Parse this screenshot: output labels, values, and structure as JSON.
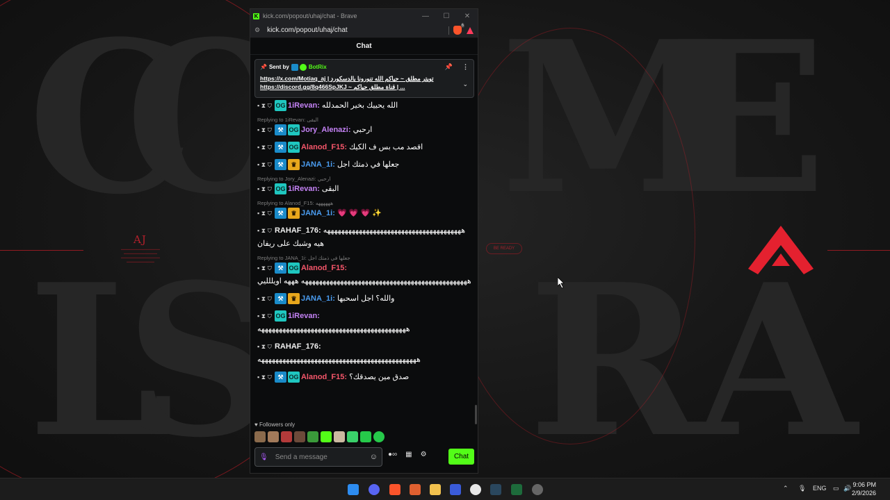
{
  "browser": {
    "window_title": "kick.com/popout/uhaj/chat - Brave",
    "url": "kick.com/popout/uhaj/chat",
    "favicon_letter": "K"
  },
  "chat": {
    "header": "Chat",
    "pinned": {
      "sent_by_label": "Sent by",
      "bot_name": "BotRix",
      "text": "https://x.com/Motiaq_aj | تويتر مطلق ~ حياكم الله تنورونا بالدسكورد https://discord.gg/8q466SpJKJ ~ قناة مطلق حياكم | ..."
    },
    "messages": [
      {
        "reply": "",
        "username": "1iRevan",
        "color": "u-purple",
        "badges": [
          "og"
        ],
        "text": "الله يحييك بخير الحمدلله"
      },
      {
        "reply": "Replying to 1iRevan: البقى",
        "username": "Jory_Alenazi",
        "color": "u-purple",
        "badges": [
          "mod",
          "og"
        ],
        "text": "ارحبي"
      },
      {
        "reply": "",
        "username": "Alanod_F15",
        "color": "u-red",
        "badges": [
          "mod",
          "og"
        ],
        "text": "اقصد مب بس ف الكيك"
      },
      {
        "reply": "",
        "username": "JANA_1i",
        "color": "u-blue",
        "badges": [
          "mod",
          "vip"
        ],
        "text": "جعلها في ذمتك اجل"
      },
      {
        "reply": "Replying to Jory_Alenazi: ارحبي",
        "username": "1iRevan",
        "color": "u-purple",
        "badges": [
          "og"
        ],
        "text": "البقى"
      },
      {
        "reply": "Replying to Alanod_F15: ههههههه",
        "username": "JANA_1i",
        "color": "u-blue",
        "badges": [
          "mod",
          "vip"
        ],
        "text": "💗 💗 💗 ✨"
      },
      {
        "reply": "",
        "username": "RAHAF_176",
        "color": "u-white",
        "badges": [],
        "text": "هههههههههههههههههههههههههههههههههههههههه هيه وشبك على ريفان"
      },
      {
        "reply": "Replying to JANA_1i: جعلها في ذمتك اجل",
        "username": "Alanod_F15",
        "color": "u-red",
        "badges": [
          "mod",
          "og"
        ],
        "text": "هههههههههههههههههههههههههههههههههههههههههههههههه هههه اويللليي"
      },
      {
        "reply": "",
        "username": "JANA_1i",
        "color": "u-blue",
        "badges": [
          "mod",
          "vip"
        ],
        "text": "والله؟ اجل اسحبها"
      },
      {
        "reply": "",
        "username": "1iRevan",
        "color": "u-purple",
        "badges": [
          "og"
        ],
        "text": "ههههههههههههههههههههههههههههههههههههههههههه"
      },
      {
        "reply": "",
        "username": "RAHAF_176",
        "color": "u-white",
        "badges": [],
        "text": "هههههههههههههههههههههههههههههههههههههههههههههه"
      },
      {
        "reply": "",
        "username": "Alanod_F15",
        "color": "u-red",
        "badges": [
          "mod",
          "og"
        ],
        "text": "صدق مين يصدقك؟"
      }
    ],
    "followers_only": "Followers only",
    "input_placeholder": "Send a message",
    "send_label": "Chat"
  },
  "desktop": {
    "aj_title": "AJ",
    "be_ready": "BE READY"
  },
  "taskbar": {
    "language": "ENG",
    "time": "9:06 PM",
    "date": "2/9/2026"
  },
  "colors": {
    "kick_green": "#53fc18",
    "accent_red": "#c81e28"
  }
}
